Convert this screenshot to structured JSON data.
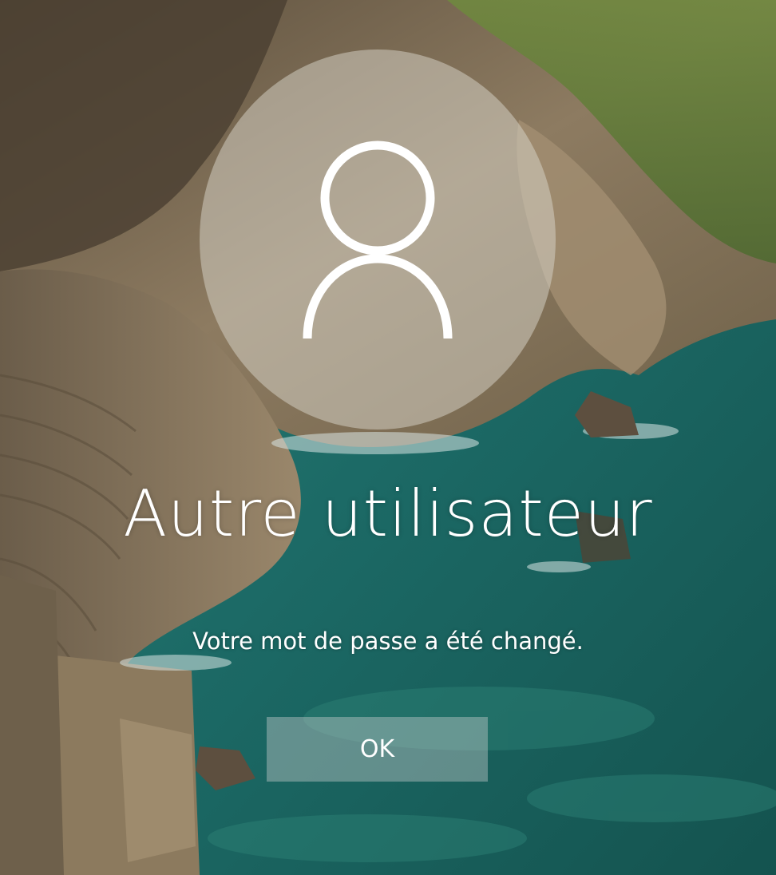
{
  "lock_screen": {
    "username": "Autre utilisateur",
    "message": "Votre mot de passe a été changé.",
    "ok_label": "OK",
    "avatar_icon": "person-icon",
    "background": "coastal-cliffs-with-stone-stairway-and-turquoise-sea"
  },
  "colors": {
    "text": "#ffffff",
    "sea": "#1f6e6a",
    "rock": "#8a7a62"
  }
}
